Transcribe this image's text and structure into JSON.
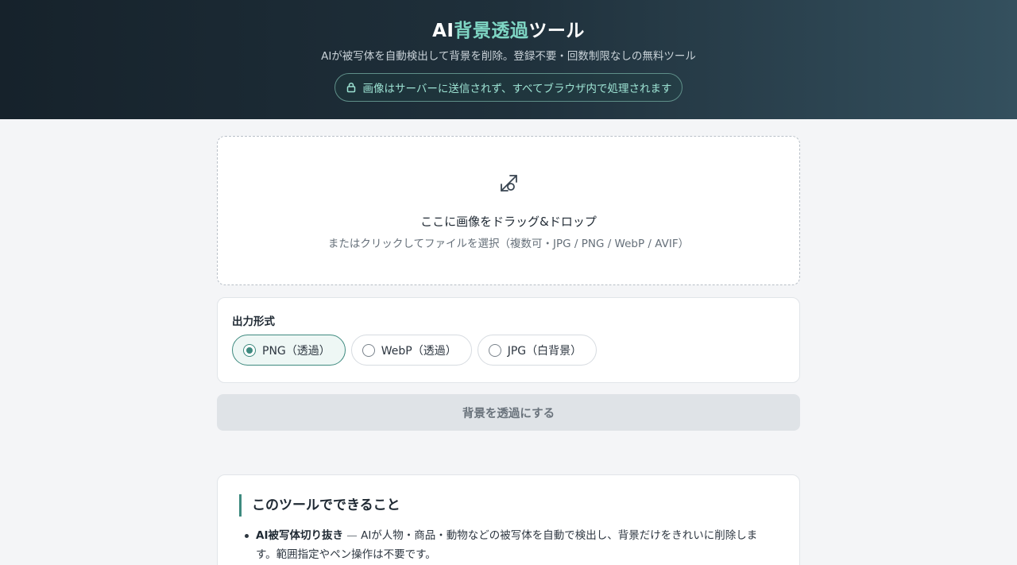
{
  "header": {
    "title_prefix": "AI",
    "title_accent": "背景透過",
    "title_suffix": "ツール",
    "subtitle": "AIが被写体を自動検出して背景を削除。登録不要・回数制限なしの無料ツール",
    "privacy_text": "画像はサーバーに送信されず、すべてブラウザ内で処理されます",
    "privacy_icon": "lock-icon"
  },
  "dropzone": {
    "icon": "arrows-image-icon",
    "title": "ここに画像をドラッグ&ドロップ",
    "subtitle": "またはクリックしてファイルを選択（複数可・JPG / PNG / WebP / AVIF）"
  },
  "format": {
    "label": "出力形式",
    "options": [
      {
        "label": "PNG（透過）",
        "selected": true
      },
      {
        "label": "WebP（透過）",
        "selected": false
      },
      {
        "label": "JPG（白背景）",
        "selected": false
      }
    ]
  },
  "action": {
    "label": "背景を透過にする",
    "disabled": true
  },
  "info": {
    "heading": "このツールでできること",
    "items": [
      {
        "title": "AI被写体切り抜き",
        "separator": "—",
        "text": "AIが人物・商品・動物などの被写体を自動で検出し、背景だけをきれいに削除します。範囲指定やペン操作は不要です。"
      }
    ]
  },
  "colors": {
    "accent": "#7fd6c4",
    "primary": "#3e8a7f",
    "header_dark": "#16222b",
    "header_light": "#34505e"
  }
}
